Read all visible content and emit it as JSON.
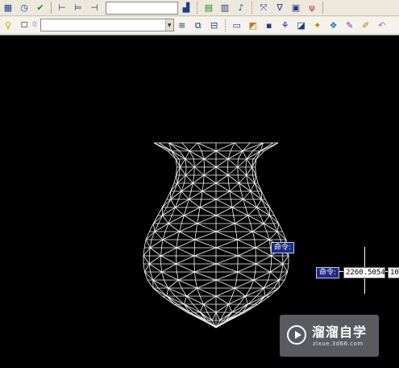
{
  "toolbar": {
    "row1_icons": [
      "grid-icon",
      "clock-icon",
      "layer-check-icon",
      "measure-horizontal-icon",
      "measure-aligned-icon",
      "measure-box-icon",
      "plot-icon",
      "table-edit-icon",
      "notes-icon",
      "paste-icon",
      "cursor-icon",
      "compass-icon",
      "list-icon",
      "pin-icon"
    ],
    "combo_placeholder": "",
    "layer_state": "0",
    "row2_icons": [
      "layer-stack-icon",
      "layer-move-icon",
      "layer-lock-icon",
      "new-sheet-icon",
      "open-icon",
      "save-icon",
      "publish-icon",
      "preview-icon",
      "zoom-icon",
      "3d-orbit-icon",
      "pencil-icon",
      "brush-icon",
      "undo-icon"
    ]
  },
  "command": {
    "tip_near_object": "命令:",
    "tip_label": "命令:",
    "input_value": "2260.5054",
    "input_cut": "10"
  },
  "watermark": {
    "title": "溜溜自学",
    "subtitle": "zixue.3d66.com"
  }
}
